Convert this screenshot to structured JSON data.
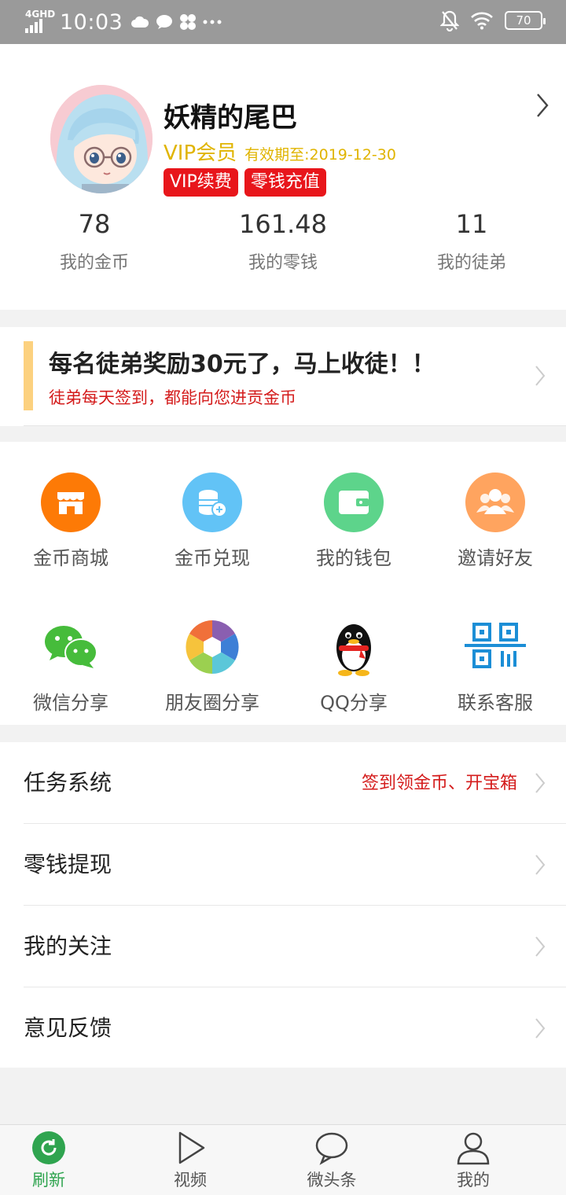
{
  "status_bar": {
    "network": "4GHD",
    "time": "10:03",
    "notification_icons": [
      "cloud-icon",
      "chat-bubble-icon",
      "fan-icon",
      "more-icon"
    ],
    "battery": "70"
  },
  "profile": {
    "username": "妖精的尾巴",
    "vip_label": "VIP会员",
    "expiry": "有效期至:2019-12-30",
    "renew_button": "VIP续费",
    "recharge_button": "零钱充值",
    "stats": [
      {
        "value": "78",
        "label": "我的金币"
      },
      {
        "value": "161.48",
        "label": "我的零钱"
      },
      {
        "value": "11",
        "label": "我的徒弟"
      }
    ]
  },
  "banner": {
    "title": "每名徒弟奖励30元了，马上收徒！！",
    "subtitle": "徒弟每天签到，都能向您进贡金币"
  },
  "grid": [
    {
      "label": "金币商城",
      "icon": "store-icon",
      "color": "#fd7a06"
    },
    {
      "label": "金币兑现",
      "icon": "coin-exchange-icon",
      "color": "#62c3f6"
    },
    {
      "label": "我的钱包",
      "icon": "wallet-icon",
      "color": "#5dd48b"
    },
    {
      "label": "邀请好友",
      "icon": "invite-friends-icon",
      "color": "#ffa45f"
    },
    {
      "label": "微信分享",
      "icon": "wechat-icon",
      "color": "#46bc3b"
    },
    {
      "label": "朋友圈分享",
      "icon": "moments-icon",
      "color": "#7fb24a"
    },
    {
      "label": "QQ分享",
      "icon": "qq-icon",
      "color": "#111111"
    },
    {
      "label": "联系客服",
      "icon": "qr-code-icon",
      "color": "#1b8ed6"
    }
  ],
  "list": [
    {
      "label": "任务系统",
      "hint": "签到领金币、开宝箱"
    },
    {
      "label": "零钱提现",
      "hint": ""
    },
    {
      "label": "我的关注",
      "hint": ""
    },
    {
      "label": "意见反馈",
      "hint": ""
    }
  ],
  "tabs": [
    {
      "label": "刷新",
      "icon": "refresh-icon",
      "active": true
    },
    {
      "label": "视频",
      "icon": "play-icon",
      "active": false
    },
    {
      "label": "微头条",
      "icon": "speech-bubble-icon",
      "active": false
    },
    {
      "label": "我的",
      "icon": "user-icon",
      "active": false
    }
  ],
  "colors": {
    "accent_green": "#2fa44f",
    "vip_gold": "#e0b400",
    "badge_red": "#e8161b",
    "hint_red": "#d41c1c"
  }
}
